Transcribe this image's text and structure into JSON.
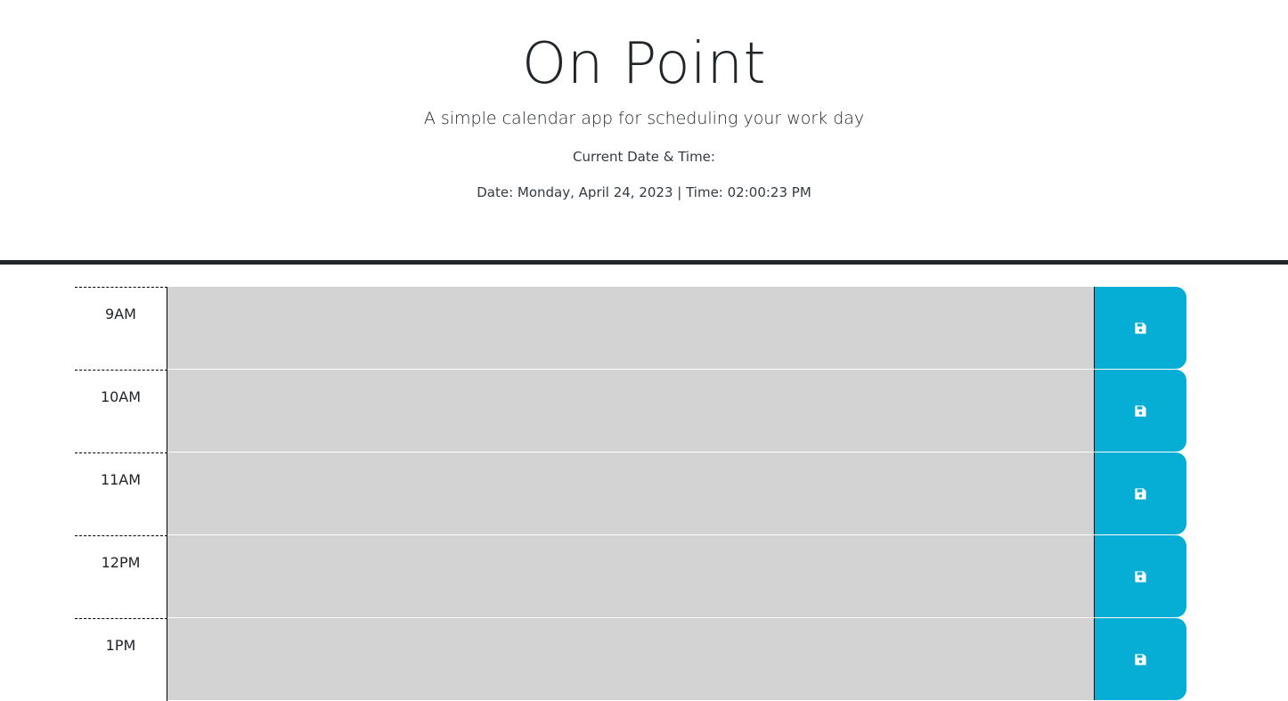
{
  "header": {
    "title": "On Point",
    "lead": "A simple calendar app for scheduling your work day",
    "current_label": "Current Date & Time:",
    "datetime": "Date: Monday, April 24, 2023 | Time: 02:00:23 PM"
  },
  "schedule": {
    "rows": [
      {
        "hour": "9AM",
        "text": ""
      },
      {
        "hour": "10AM",
        "text": ""
      },
      {
        "hour": "11AM",
        "text": ""
      },
      {
        "hour": "12PM",
        "text": ""
      },
      {
        "hour": "1PM",
        "text": ""
      }
    ],
    "save_icon": "floppy-disk-icon"
  },
  "colors": {
    "row_background": "#d3d3d3",
    "save_button": "#06aed5",
    "divider": "#212529"
  }
}
